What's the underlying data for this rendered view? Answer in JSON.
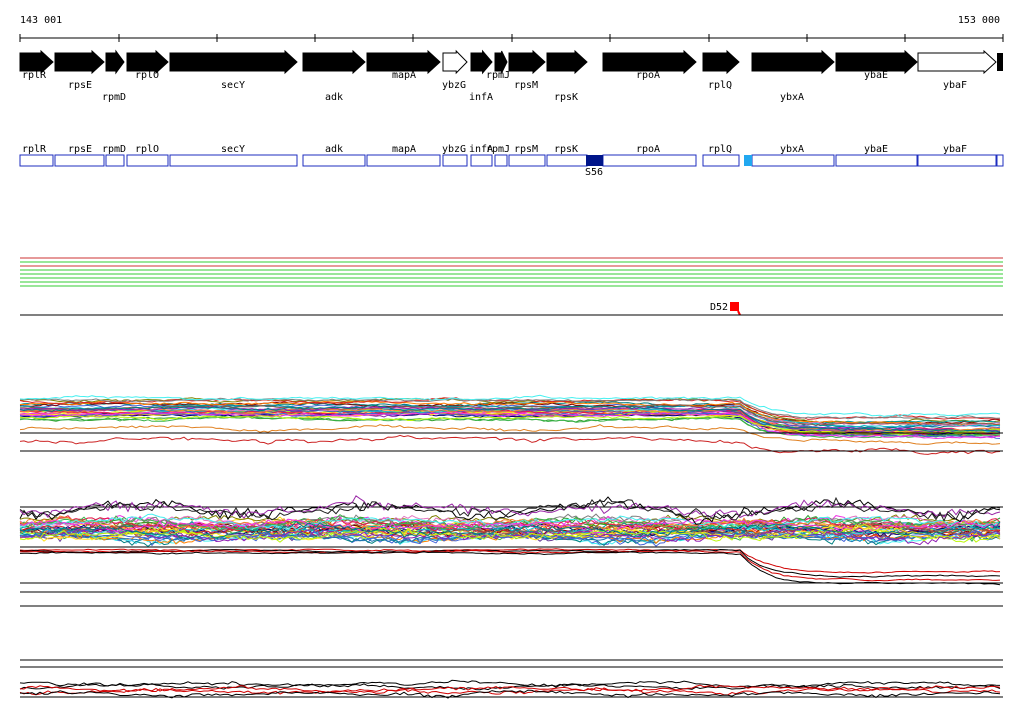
{
  "ruler": {
    "start_label": "143 001",
    "end_label": "153 000"
  },
  "genes": [
    {
      "name": "rplR",
      "strand": "+",
      "filled": true
    },
    {
      "name": "rpsE",
      "strand": "+",
      "filled": true
    },
    {
      "name": "rpmD",
      "strand": "+",
      "filled": true
    },
    {
      "name": "rplO",
      "strand": "+",
      "filled": true
    },
    {
      "name": "secY",
      "strand": "+",
      "filled": true
    },
    {
      "name": "adk",
      "strand": "+",
      "filled": true
    },
    {
      "name": "mapA",
      "strand": "+",
      "filled": true
    },
    {
      "name": "ybzG",
      "strand": "+",
      "filled": false
    },
    {
      "name": "infA",
      "strand": "+",
      "filled": true
    },
    {
      "name": "rpmJ",
      "strand": "+",
      "filled": true
    },
    {
      "name": "rpsM",
      "strand": "+",
      "filled": true
    },
    {
      "name": "rpsK",
      "strand": "+",
      "filled": true
    },
    {
      "name": "rpoA",
      "strand": "+",
      "filled": true
    },
    {
      "name": "rplQ",
      "strand": "+",
      "filled": true
    },
    {
      "name": "ybxA",
      "strand": "+",
      "filled": true
    },
    {
      "name": "ybaE",
      "strand": "+",
      "filled": true
    },
    {
      "name": "ybaF",
      "strand": "+",
      "filled": false
    }
  ],
  "annotation_track": {
    "boxes": [
      "rplR",
      "rpsE",
      "rpmD",
      "rplO",
      "secY",
      "adk",
      "mapA",
      "ybzG",
      "infA",
      "rpmJ",
      "rpsM",
      "rpsK",
      "rpoA",
      "rplQ",
      "ybxA",
      "ybaE",
      "ybaF"
    ],
    "markers": [
      {
        "label": "S56",
        "color": "#00158a"
      },
      {
        "label": "",
        "color": "#22a8f0"
      }
    ]
  },
  "variant_marker": {
    "label": "D52",
    "color": "#ff0000"
  },
  "colors": {
    "gene": "#000000",
    "track_border": "#1e2dbf",
    "rule_green": "#33cc33",
    "rule_red": "#cc3333",
    "low_line": "#e00000"
  }
}
